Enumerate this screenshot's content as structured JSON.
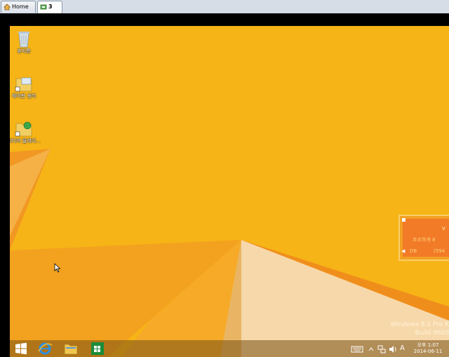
{
  "tabs": [
    {
      "label": "Home",
      "icon": "home-icon"
    },
    {
      "label": "3",
      "icon": "vm-icon"
    }
  ],
  "desktop": {
    "icons": [
      {
        "label": "휴지통",
        "icon": "recycle-bin-icon"
      },
      {
        "label": "제어판 센터",
        "icon": "control-panel-folder-icon"
      },
      {
        "label": "미디어 플레이...",
        "icon": "media-player-folder-icon"
      }
    ]
  },
  "notification": {
    "title": "V",
    "message": "초조하게 8",
    "left": "DB",
    "right": "(594"
  },
  "watermark": {
    "line1": "Windows 8.1 Pro K",
    "line2": "Build 9600"
  },
  "taskbar": {
    "apps": [
      "start-icon",
      "internet-explorer-icon",
      "file-explorer-icon",
      "store-icon"
    ],
    "tray": {
      "ime": "A"
    },
    "clock": {
      "time": "오후 1:07",
      "date": "2014-06-11"
    }
  },
  "colors": {
    "wallpaper": "#f6b416",
    "notification": "#f27b27"
  }
}
